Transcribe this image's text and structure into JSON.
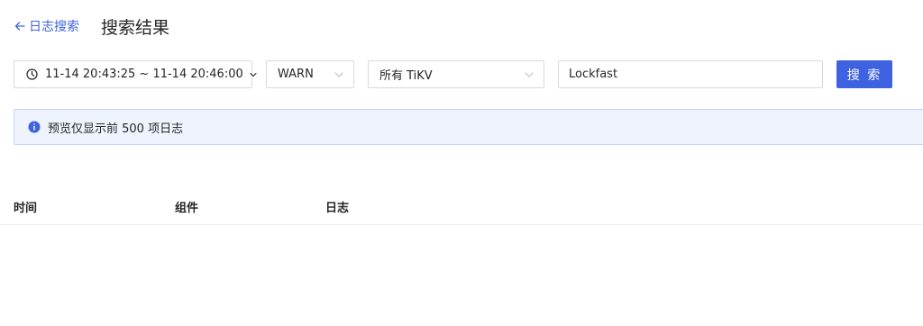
{
  "header": {
    "back_label": "日志搜索",
    "title": "搜索结果"
  },
  "toolbar": {
    "time_range": "11-14 20:43:25 ~ 11-14 20:46:00",
    "level": "WARN",
    "instance": "所有 TiKV",
    "search_value": "Lockfast",
    "search_button_label": "搜 索"
  },
  "alert": {
    "message": "预览仅显示前 500 项日志"
  },
  "table": {
    "columns": [
      "时间",
      "组件",
      "日志"
    ],
    "rows": []
  },
  "colors": {
    "accent": "#3f63e0",
    "alert_bg": "#eef3fe",
    "alert_border": "#c6d4f8"
  },
  "icons": {
    "back": "arrow-left-icon",
    "time": "clock-icon",
    "dropdown": "chevron-down-icon",
    "info": "info-circle-icon"
  }
}
